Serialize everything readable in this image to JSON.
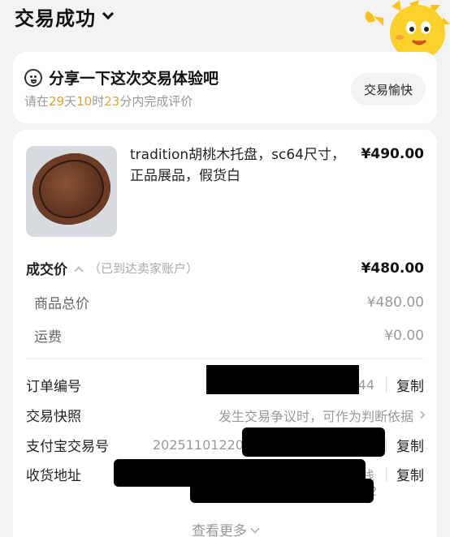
{
  "header": {
    "title": "交易成功"
  },
  "feedback": {
    "prompt": "分享一下这次交易体验吧",
    "countdown": {
      "prefix": "请在",
      "days": "29",
      "d_unit": "天",
      "hours": "10",
      "h_unit": "时",
      "minutes": "23",
      "m_unit": "分内完成评价"
    },
    "button_label": "交易愉快"
  },
  "product": {
    "name": "tradition胡桃木托盘，sc64尺寸，正品展品，假货白",
    "price": "¥490.00"
  },
  "pricing": {
    "deal_label": "成交价",
    "deal_note": "（已到达卖家账户）",
    "deal_price": "¥480.00",
    "subtotal_label": "商品总价",
    "subtotal_value": "¥480.00",
    "shipping_label": "运费",
    "shipping_value": "¥0.00"
  },
  "order_info": {
    "order_no_label": "订单编号",
    "order_no_visible": "44",
    "snapshot_label": "交易快照",
    "snapshot_value": "发生交易争议时，可作为判断依据",
    "alipay_label": "支付宝交易号",
    "alipay_visible": "20251101220",
    "address_label": "收货地址",
    "address_visible_1": "栈",
    "address_visible_2": "2",
    "copy_label": "复制"
  },
  "footer": {
    "more_label": "查看更多"
  },
  "colors": {
    "accent": "#e0a32d",
    "background": "#f3f3f4"
  }
}
